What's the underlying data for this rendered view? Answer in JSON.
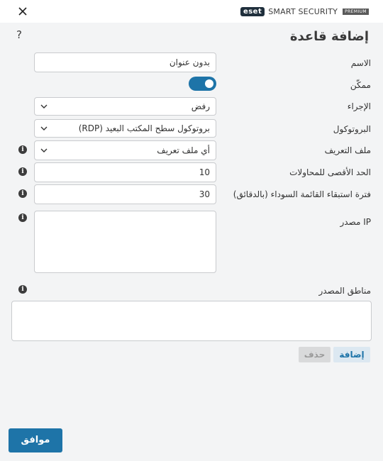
{
  "brand": {
    "logo": "eset",
    "product": "SMART SECURITY",
    "edition": "PREMIUM"
  },
  "window": {
    "close_icon": "close-icon",
    "help_icon": "?"
  },
  "title": "إضافة قاعدة",
  "form": {
    "name": {
      "label": "الاسم",
      "value": "بدون عنوان"
    },
    "enabled": {
      "label": "ممكّن",
      "value": true
    },
    "action": {
      "label": "الإجراء",
      "value": "رفض"
    },
    "protocol": {
      "label": "البروتوكول",
      "value": "بروتوكول سطح المكتب البعيد (RDP)"
    },
    "profile": {
      "label": "ملف التعريف",
      "value": "أي ملف تعريف"
    },
    "max_attempts": {
      "label": "الحد الأقصى للمحاولات",
      "value": "10"
    },
    "blacklist_period": {
      "label": "فترة استبقاء القائمة السوداء (بالدقائق)",
      "value": "30"
    },
    "source_ip": {
      "label": "IP مصدر",
      "value": ""
    },
    "source_zones": {
      "label": "مناطق المصدر"
    }
  },
  "buttons": {
    "add": "إضافة",
    "remove": "حذف",
    "ok": "موافق"
  },
  "colors": {
    "accent": "#1e74a8",
    "background": "#f3f4f5"
  }
}
